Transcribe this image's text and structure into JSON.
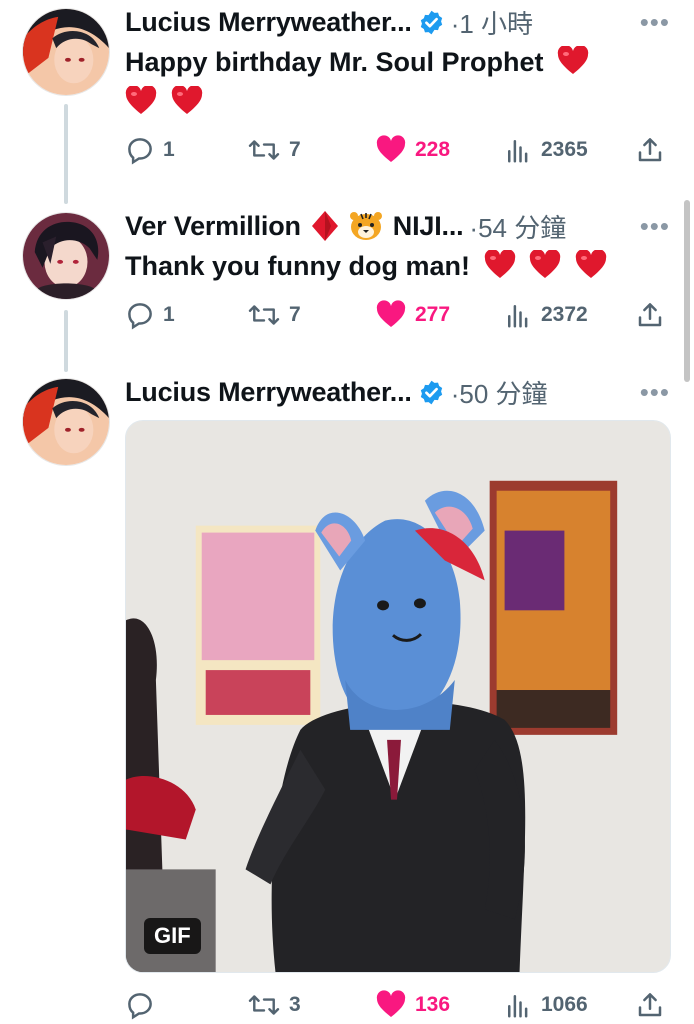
{
  "tweets": [
    {
      "author": "Lucius Merryweather...",
      "meta": "·1 小時",
      "text": "Happy birthday Mr. Soul Prophet",
      "heart_count_inline": 3,
      "stats": {
        "replies": "1",
        "retweets": "7",
        "likes": "228",
        "views": "2365"
      }
    },
    {
      "author": "Ver Vermillion",
      "author_suffix": "NIJI...",
      "meta": "·54 分鐘",
      "text": "Thank you funny dog man!",
      "heart_count_inline": 3,
      "stats": {
        "replies": "1",
        "retweets": "7",
        "likes": "277",
        "views": "2372"
      }
    },
    {
      "author": "Lucius Merryweather...",
      "meta": "·50 分鐘",
      "media_badge": "GIF",
      "stats": {
        "replies": "",
        "retweets": "3",
        "likes": "136",
        "views": "1066"
      }
    }
  ],
  "icons": {
    "more": "more-dots-icon",
    "verified": "verified-badge-icon",
    "reply": "reply-icon",
    "retweet": "retweet-icon",
    "like": "heart-icon",
    "views": "views-icon",
    "share": "share-icon"
  },
  "colors": {
    "like": "#f91880",
    "verified": "#1d9bf0",
    "muted": "#536471",
    "heart_emoji": "#e0182d"
  }
}
